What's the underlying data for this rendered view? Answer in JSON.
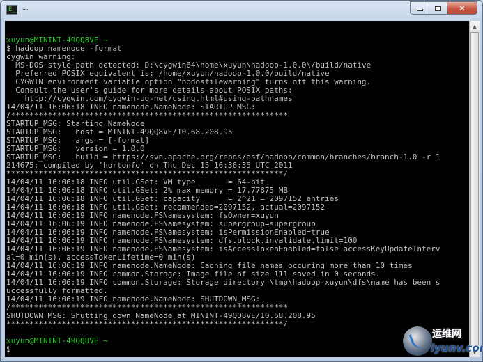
{
  "window": {
    "title": "~",
    "app_icon": "cygwin-terminal-icon",
    "app_icon_glyph": "E_",
    "minimize_icon": "minimize-icon",
    "maximize_icon": "maximize-icon",
    "close_icon": "close-icon",
    "close_glyph": "✕"
  },
  "terminal": {
    "lines": [
      {
        "text": "",
        "color": "default"
      },
      {
        "text": "xuyun@MININT-49QQ8VE ~",
        "color": "green"
      },
      {
        "text": "$ hadoop namenode -format",
        "color": "default"
      },
      {
        "text": "cygwin warning:",
        "color": "default"
      },
      {
        "text": "  MS-DOS style path detected: D:\\cygwin64\\home\\xuyun\\hadoop-1.0.0\\/build/native",
        "color": "default"
      },
      {
        "text": "  Preferred POSIX equivalent is: /home/xuyun/hadoop-1.0.0/build/native",
        "color": "default"
      },
      {
        "text": "  CYGWIN environment variable option \"nodosfilewarning\" turns off this warning.",
        "color": "default"
      },
      {
        "text": "  Consult the user's guide for more details about POSIX paths:",
        "color": "default"
      },
      {
        "text": "    http://cygwin.com/cygwin-ug-net/using.html#using-pathnames",
        "color": "default"
      },
      {
        "text": "14/04/11 16:06:18 INFO namenode.NameNode: STARTUP_MSG:",
        "color": "default"
      },
      {
        "text": "/************************************************************",
        "color": "default"
      },
      {
        "text": "STARTUP_MSG: Starting NameNode",
        "color": "default"
      },
      {
        "text": "STARTUP_MSG:   host = MININT-49QQ8VE/10.68.208.95",
        "color": "default"
      },
      {
        "text": "STARTUP_MSG:   args = [-format]",
        "color": "default"
      },
      {
        "text": "STARTUP_MSG:   version = 1.0.0",
        "color": "default"
      },
      {
        "text": "STARTUP_MSG:   build = https://svn.apache.org/repos/asf/hadoop/common/branches/branch-1.0 -r 1",
        "color": "default"
      },
      {
        "text": "214675; compiled by 'hortonfo' on Thu Dec 15 16:36:35 UTC 2011",
        "color": "default"
      },
      {
        "text": "************************************************************/",
        "color": "default"
      },
      {
        "text": "14/04/11 16:06:18 INFO util.GSet: VM type       = 64-bit",
        "color": "default"
      },
      {
        "text": "14/04/11 16:06:18 INFO util.GSet: 2% max memory = 17.77875 MB",
        "color": "default"
      },
      {
        "text": "14/04/11 16:06:18 INFO util.GSet: capacity      = 2^21 = 2097152 entries",
        "color": "default"
      },
      {
        "text": "14/04/11 16:06:18 INFO util.GSet: recommended=2097152, actual=2097152",
        "color": "default"
      },
      {
        "text": "14/04/11 16:06:19 INFO namenode.FSNamesystem: fsOwner=xuyun",
        "color": "default"
      },
      {
        "text": "14/04/11 16:06:19 INFO namenode.FSNamesystem: supergroup=supergroup",
        "color": "default"
      },
      {
        "text": "14/04/11 16:06:19 INFO namenode.FSNamesystem: isPermissionEnabled=true",
        "color": "default"
      },
      {
        "text": "14/04/11 16:06:19 INFO namenode.FSNamesystem: dfs.block.invalidate.limit=100",
        "color": "default"
      },
      {
        "text": "14/04/11 16:06:19 INFO namenode.FSNamesystem: isAccessTokenEnabled=false accessKeyUpdateInterv",
        "color": "default"
      },
      {
        "text": "al=0 min(s), accessTokenLifetime=0 min(s)",
        "color": "default"
      },
      {
        "text": "14/04/11 16:06:19 INFO namenode.NameNode: Caching file names occuring more than 10 times",
        "color": "default"
      },
      {
        "text": "14/04/11 16:06:19 INFO common.Storage: Image file of size 111 saved in 0 seconds.",
        "color": "default"
      },
      {
        "text": "14/04/11 16:06:19 INFO common.Storage: Storage directory \\tmp\\hadoop-xuyun\\dfs\\name has been s",
        "color": "default"
      },
      {
        "text": "uccessfully formatted.",
        "color": "default"
      },
      {
        "text": "14/04/11 16:06:19 INFO namenode.NameNode: SHUTDOWN_MSG:",
        "color": "default"
      },
      {
        "text": "/************************************************************",
        "color": "default"
      },
      {
        "text": "SHUTDOWN_MSG: Shutting down NameNode at MININT-49QQ8VE/10.68.208.95",
        "color": "default"
      },
      {
        "text": "************************************************************/",
        "color": "default"
      },
      {
        "text": "",
        "color": "default"
      },
      {
        "text": "xuyun@MININT-49QQ8VE ~",
        "color": "green"
      },
      {
        "text": "$",
        "color": "default"
      }
    ]
  },
  "watermark": {
    "line1": "运维网",
    "line2": "iyunv.com"
  },
  "colors": {
    "terminal_bg": "#000000",
    "terminal_fg": "#c0c0c0",
    "prompt_green": "#26c826"
  }
}
